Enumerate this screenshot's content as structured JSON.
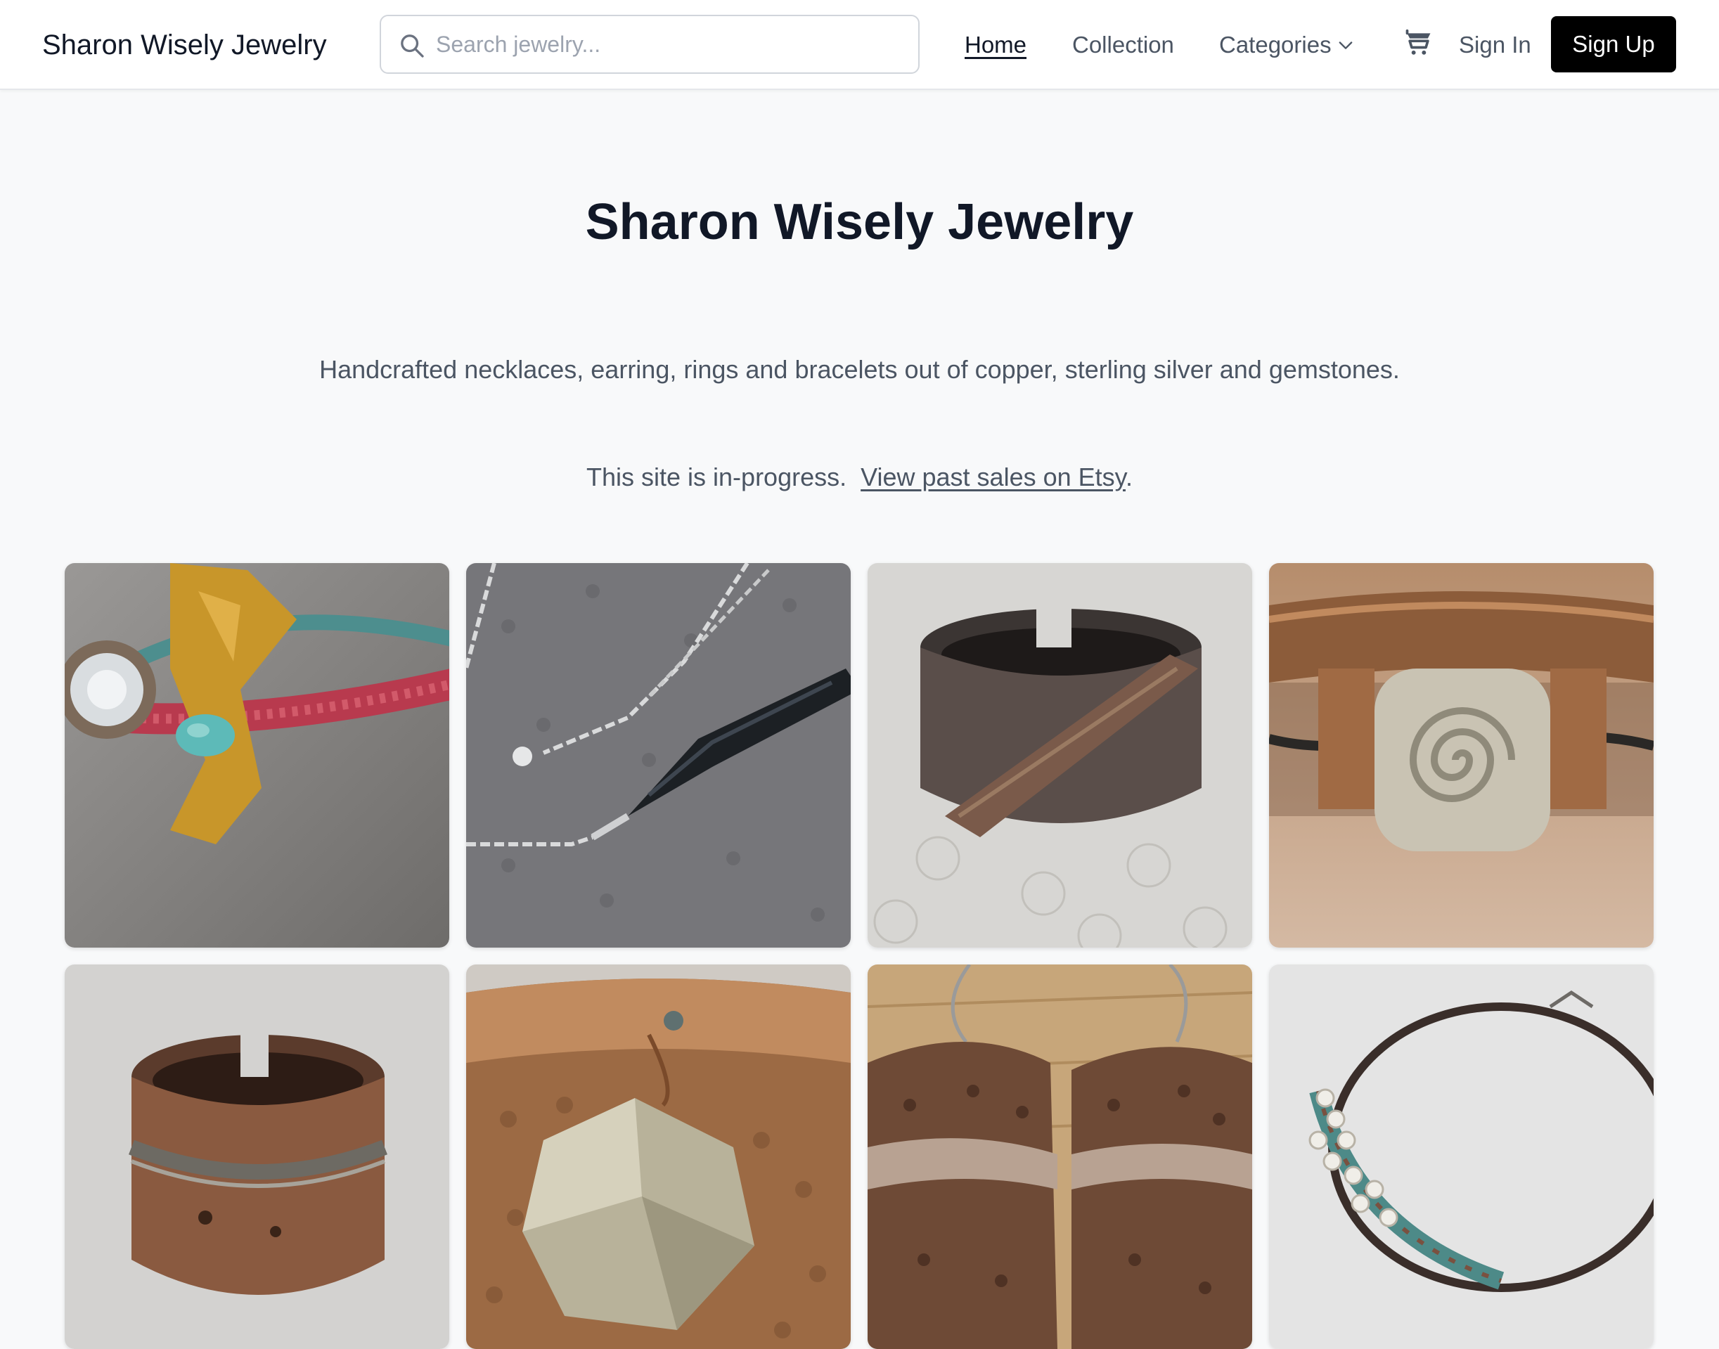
{
  "header": {
    "brand": "Sharon Wisely Jewelry",
    "search_placeholder": "Search jewelry...",
    "nav": {
      "home": "Home",
      "collection": "Collection",
      "categories": "Categories"
    },
    "sign_in": "Sign In",
    "sign_up": "Sign Up"
  },
  "hero": {
    "title": "Sharon Wisely Jewelry",
    "subtitle": "Handcrafted necklaces, earring, rings and bracelets out of copper, sterling silver and gemstones.",
    "note_text": "This site is in-progress.",
    "note_link": "View past sales on Etsy",
    "note_suffix": "."
  },
  "products": [
    {
      "icon": "bracelet-fabric-turquoise-image"
    },
    {
      "icon": "necklace-chain-pendant-image"
    },
    {
      "icon": "copper-ring-image"
    },
    {
      "icon": "spiral-cuff-bracelet-image"
    },
    {
      "icon": "copper-band-ring-image"
    },
    {
      "icon": "pyrite-cuff-bracelet-image"
    },
    {
      "icon": "copper-disc-earrings-image"
    },
    {
      "icon": "wrapped-bangle-image"
    }
  ]
}
